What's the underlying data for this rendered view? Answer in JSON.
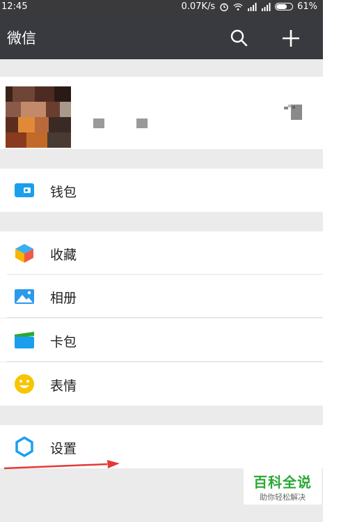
{
  "statusbar": {
    "time": "12:45",
    "net_speed": "0.07K/s",
    "battery": "61%",
    "battery_level": 0.61,
    "icons": [
      "alarm-icon",
      "wifi-icon",
      "signal-icon",
      "signal-icon",
      "battery-icon"
    ]
  },
  "header": {
    "title": "微信",
    "icons": [
      "search-icon",
      "plus-icon"
    ]
  },
  "menu": {
    "wallet": "钱包",
    "favorites": "收藏",
    "album": "相册",
    "cards": "卡包",
    "stickers": "表情",
    "settings": "设置"
  },
  "watermark": {
    "title": "百科全说",
    "subtitle": "助你轻松解决"
  },
  "colors": {
    "header_bg": "#393a3f",
    "page_bg": "#ebebeb",
    "wallet_blue": "#1a9fee",
    "settings_blue": "#1a9fee",
    "sticker_yellow": "#f7c600",
    "arrow_red": "#e53935",
    "watermark_green": "#2aa835"
  }
}
